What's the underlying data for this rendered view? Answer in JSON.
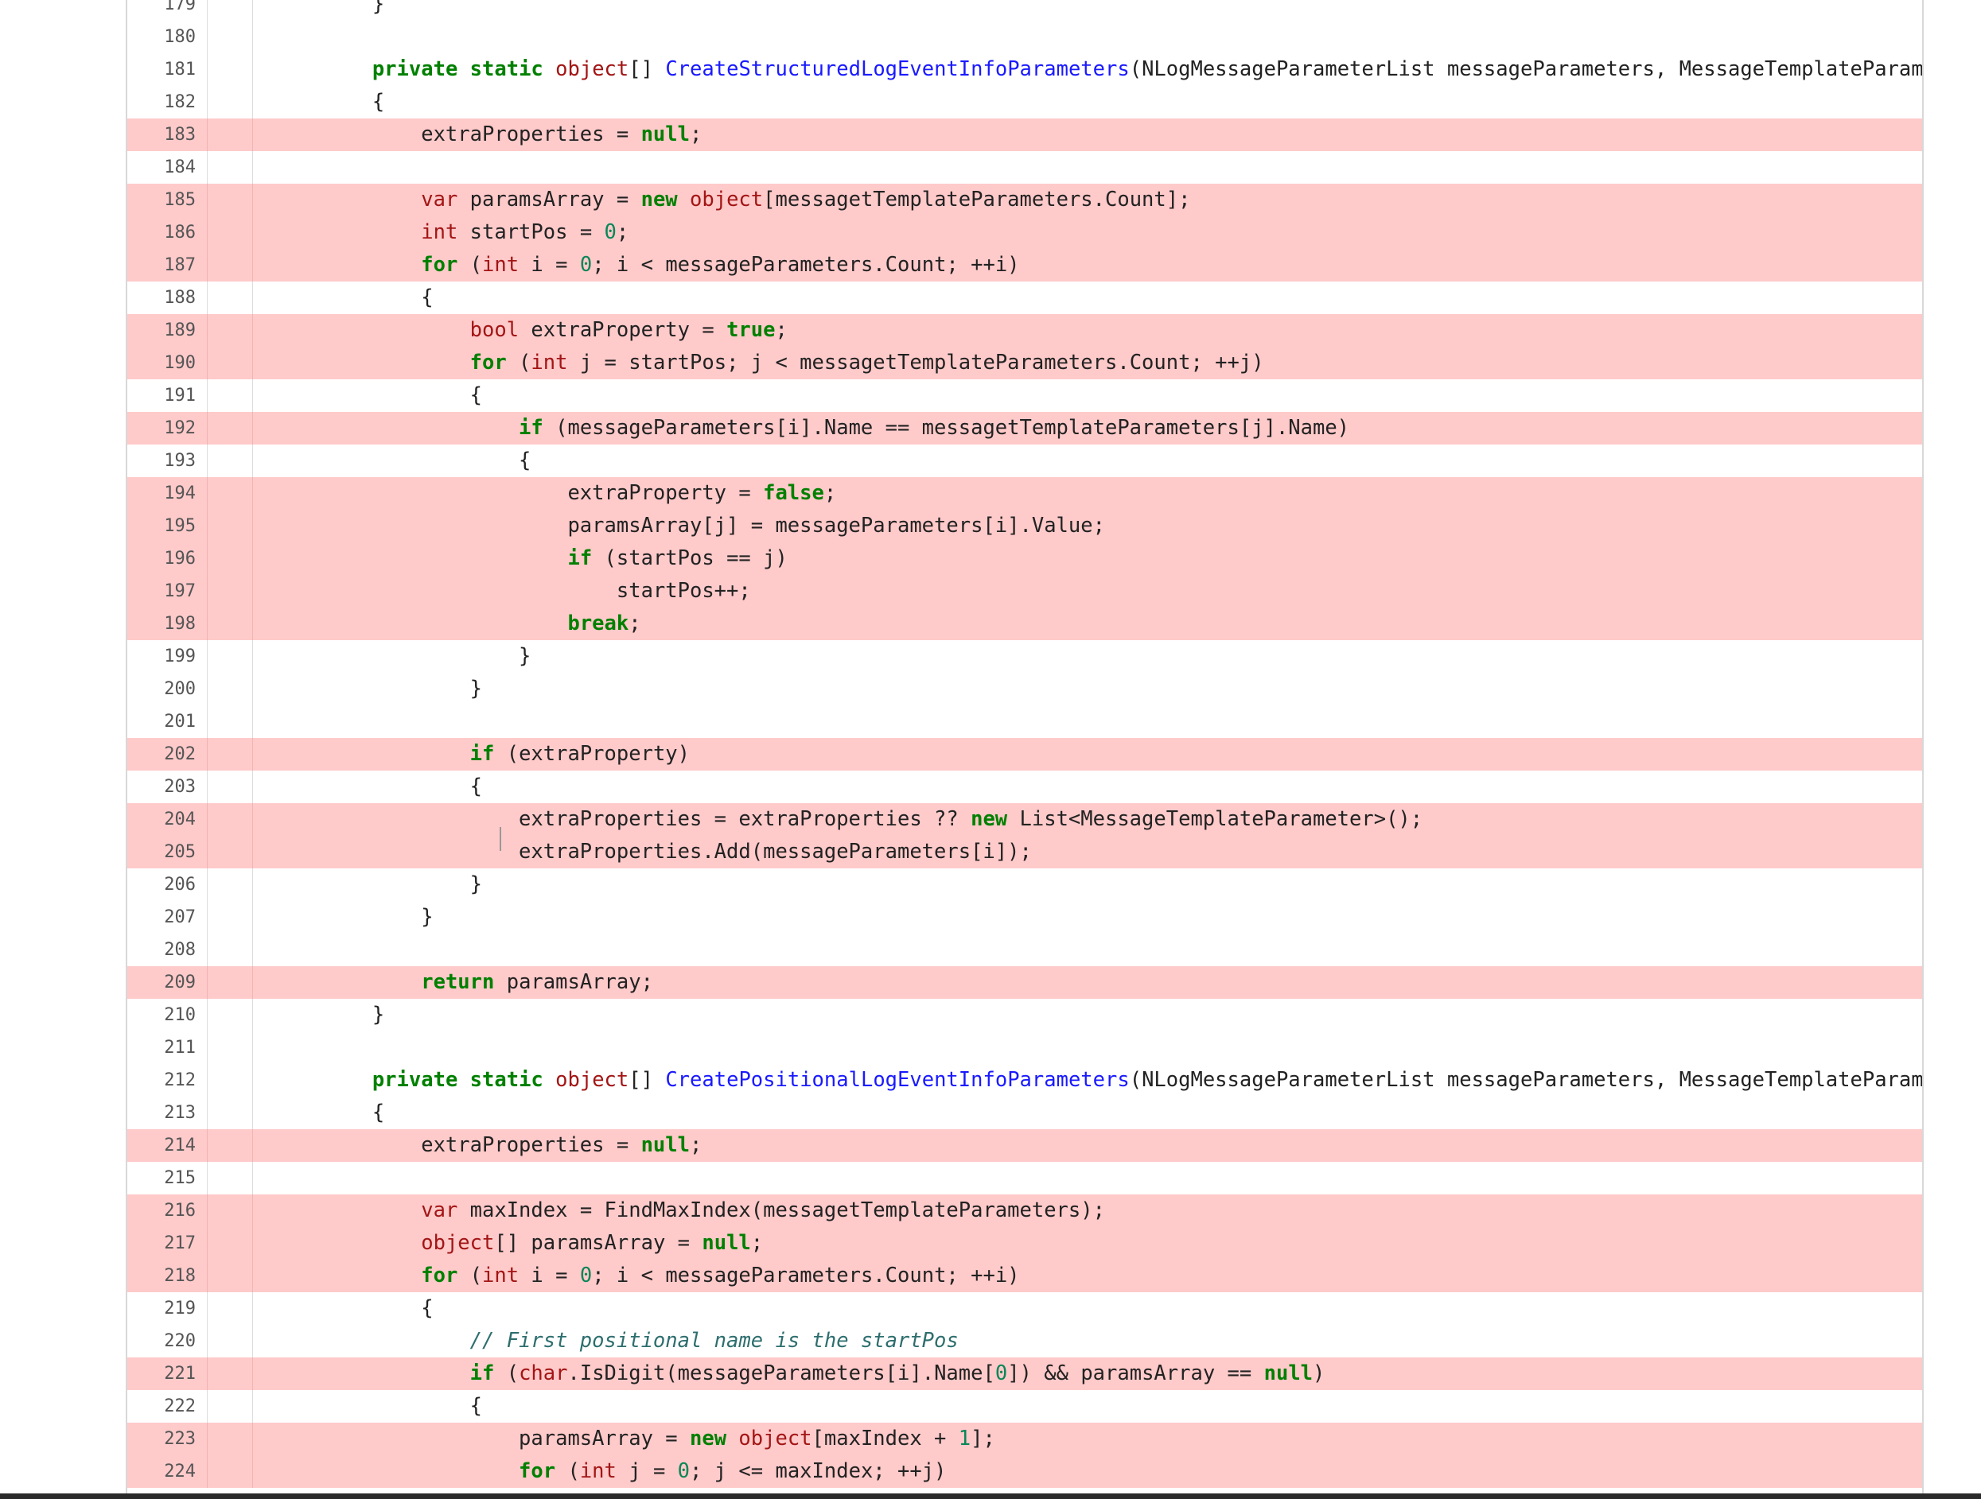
{
  "colors": {
    "highlight": "#ffcaca",
    "keyword": "#008000",
    "type": "#a31515",
    "function": "#1a1aff",
    "number": "#098658",
    "comment": "#2e6e6e"
  },
  "code_lines": [
    {
      "num": "179",
      "hl": false,
      "tokens": [
        [
          "p",
          "        }"
        ]
      ]
    },
    {
      "num": "180",
      "hl": false,
      "tokens": []
    },
    {
      "num": "181",
      "hl": false,
      "tokens": [
        [
          "p",
          "        "
        ],
        [
          "kw",
          "private"
        ],
        [
          "p",
          " "
        ],
        [
          "kw",
          "static"
        ],
        [
          "p",
          " "
        ],
        [
          "ty",
          "object"
        ],
        [
          "p",
          "[] "
        ],
        [
          "fn",
          "CreateStructuredLogEventInfoParameters"
        ],
        [
          "p",
          "(NLogMessageParameterList messageParameters, MessageTemplateParameters messa"
        ]
      ]
    },
    {
      "num": "182",
      "hl": false,
      "tokens": [
        [
          "p",
          "        {"
        ]
      ]
    },
    {
      "num": "183",
      "hl": true,
      "tokens": [
        [
          "p",
          "            extraProperties = "
        ],
        [
          "kw",
          "null"
        ],
        [
          "p",
          ";"
        ]
      ]
    },
    {
      "num": "184",
      "hl": false,
      "tokens": []
    },
    {
      "num": "185",
      "hl": true,
      "tokens": [
        [
          "p",
          "            "
        ],
        [
          "ty",
          "var"
        ],
        [
          "p",
          " paramsArray = "
        ],
        [
          "kw",
          "new"
        ],
        [
          "p",
          " "
        ],
        [
          "ty",
          "object"
        ],
        [
          "p",
          "[messagetTemplateParameters.Count];"
        ]
      ]
    },
    {
      "num": "186",
      "hl": true,
      "tokens": [
        [
          "p",
          "            "
        ],
        [
          "ty",
          "int"
        ],
        [
          "p",
          " startPos = "
        ],
        [
          "num",
          "0"
        ],
        [
          "p",
          ";"
        ]
      ]
    },
    {
      "num": "187",
      "hl": true,
      "tokens": [
        [
          "p",
          "            "
        ],
        [
          "kw",
          "for"
        ],
        [
          "p",
          " ("
        ],
        [
          "ty",
          "int"
        ],
        [
          "p",
          " i = "
        ],
        [
          "num",
          "0"
        ],
        [
          "p",
          "; i < messageParameters.Count; ++i)"
        ]
      ]
    },
    {
      "num": "188",
      "hl": false,
      "tokens": [
        [
          "p",
          "            {"
        ]
      ]
    },
    {
      "num": "189",
      "hl": true,
      "tokens": [
        [
          "p",
          "                "
        ],
        [
          "ty",
          "bool"
        ],
        [
          "p",
          " extraProperty = "
        ],
        [
          "kw",
          "true"
        ],
        [
          "p",
          ";"
        ]
      ]
    },
    {
      "num": "190",
      "hl": true,
      "tokens": [
        [
          "p",
          "                "
        ],
        [
          "kw",
          "for"
        ],
        [
          "p",
          " ("
        ],
        [
          "ty",
          "int"
        ],
        [
          "p",
          " j = startPos; j < messagetTemplateParameters.Count; ++j)"
        ]
      ]
    },
    {
      "num": "191",
      "hl": false,
      "tokens": [
        [
          "p",
          "                {"
        ]
      ]
    },
    {
      "num": "192",
      "hl": true,
      "tokens": [
        [
          "p",
          "                    "
        ],
        [
          "kw",
          "if"
        ],
        [
          "p",
          " (messageParameters[i].Name == messagetTemplateParameters[j].Name)"
        ]
      ]
    },
    {
      "num": "193",
      "hl": false,
      "tokens": [
        [
          "p",
          "                    {"
        ]
      ]
    },
    {
      "num": "194",
      "hl": true,
      "tokens": [
        [
          "p",
          "                        extraProperty = "
        ],
        [
          "kw",
          "false"
        ],
        [
          "p",
          ";"
        ]
      ]
    },
    {
      "num": "195",
      "hl": true,
      "tokens": [
        [
          "p",
          "                        paramsArray[j] = messageParameters[i].Value;"
        ]
      ]
    },
    {
      "num": "196",
      "hl": true,
      "tokens": [
        [
          "p",
          "                        "
        ],
        [
          "kw",
          "if"
        ],
        [
          "p",
          " (startPos == j)"
        ]
      ]
    },
    {
      "num": "197",
      "hl": true,
      "tokens": [
        [
          "p",
          "                            startPos++;"
        ]
      ]
    },
    {
      "num": "198",
      "hl": true,
      "tokens": [
        [
          "p",
          "                        "
        ],
        [
          "kw",
          "break"
        ],
        [
          "p",
          ";"
        ]
      ]
    },
    {
      "num": "199",
      "hl": false,
      "tokens": [
        [
          "p",
          "                    }"
        ]
      ]
    },
    {
      "num": "200",
      "hl": false,
      "tokens": [
        [
          "p",
          "                }"
        ]
      ]
    },
    {
      "num": "201",
      "hl": false,
      "tokens": []
    },
    {
      "num": "202",
      "hl": true,
      "tokens": [
        [
          "p",
          "                "
        ],
        [
          "kw",
          "if"
        ],
        [
          "p",
          " (extraProperty)"
        ]
      ]
    },
    {
      "num": "203",
      "hl": false,
      "tokens": [
        [
          "p",
          "                {"
        ]
      ]
    },
    {
      "num": "204",
      "hl": true,
      "tokens": [
        [
          "p",
          "                    extraProperties = extraProperties ?? "
        ],
        [
          "kw",
          "new"
        ],
        [
          "p",
          " List<MessageTemplateParameter>();"
        ]
      ]
    },
    {
      "num": "205",
      "hl": true,
      "tokens": [
        [
          "p",
          "                    extraProperties.Add(messageParameters[i]);"
        ]
      ]
    },
    {
      "num": "206",
      "hl": false,
      "tokens": [
        [
          "p",
          "                }"
        ]
      ]
    },
    {
      "num": "207",
      "hl": false,
      "tokens": [
        [
          "p",
          "            }"
        ]
      ]
    },
    {
      "num": "208",
      "hl": false,
      "tokens": []
    },
    {
      "num": "209",
      "hl": true,
      "tokens": [
        [
          "p",
          "            "
        ],
        [
          "kw",
          "return"
        ],
        [
          "p",
          " paramsArray;"
        ]
      ]
    },
    {
      "num": "210",
      "hl": false,
      "tokens": [
        [
          "p",
          "        }"
        ]
      ]
    },
    {
      "num": "211",
      "hl": false,
      "tokens": []
    },
    {
      "num": "212",
      "hl": false,
      "tokens": [
        [
          "p",
          "        "
        ],
        [
          "kw",
          "private"
        ],
        [
          "p",
          " "
        ],
        [
          "kw",
          "static"
        ],
        [
          "p",
          " "
        ],
        [
          "ty",
          "object"
        ],
        [
          "p",
          "[] "
        ],
        [
          "fn",
          "CreatePositionalLogEventInfoParameters"
        ],
        [
          "p",
          "(NLogMessageParameterList messageParameters, MessageTemplateParameters messa"
        ]
      ]
    },
    {
      "num": "213",
      "hl": false,
      "tokens": [
        [
          "p",
          "        {"
        ]
      ]
    },
    {
      "num": "214",
      "hl": true,
      "tokens": [
        [
          "p",
          "            extraProperties = "
        ],
        [
          "kw",
          "null"
        ],
        [
          "p",
          ";"
        ]
      ]
    },
    {
      "num": "215",
      "hl": false,
      "tokens": []
    },
    {
      "num": "216",
      "hl": true,
      "tokens": [
        [
          "p",
          "            "
        ],
        [
          "ty",
          "var"
        ],
        [
          "p",
          " maxIndex = FindMaxIndex(messagetTemplateParameters);"
        ]
      ]
    },
    {
      "num": "217",
      "hl": true,
      "tokens": [
        [
          "p",
          "            "
        ],
        [
          "ty",
          "object"
        ],
        [
          "p",
          "[] paramsArray = "
        ],
        [
          "kw",
          "null"
        ],
        [
          "p",
          ";"
        ]
      ]
    },
    {
      "num": "218",
      "hl": true,
      "tokens": [
        [
          "p",
          "            "
        ],
        [
          "kw",
          "for"
        ],
        [
          "p",
          " ("
        ],
        [
          "ty",
          "int"
        ],
        [
          "p",
          " i = "
        ],
        [
          "num",
          "0"
        ],
        [
          "p",
          "; i < messageParameters.Count; ++i)"
        ]
      ]
    },
    {
      "num": "219",
      "hl": false,
      "tokens": [
        [
          "p",
          "            {"
        ]
      ]
    },
    {
      "num": "220",
      "hl": false,
      "tokens": [
        [
          "p",
          "                "
        ],
        [
          "cm",
          "// First positional name is the startPos"
        ]
      ]
    },
    {
      "num": "221",
      "hl": true,
      "tokens": [
        [
          "p",
          "                "
        ],
        [
          "kw",
          "if"
        ],
        [
          "p",
          " ("
        ],
        [
          "ty",
          "char"
        ],
        [
          "p",
          ".IsDigit(messageParameters[i].Name["
        ],
        [
          "num",
          "0"
        ],
        [
          "p",
          "]) && paramsArray == "
        ],
        [
          "kw",
          "null"
        ],
        [
          "p",
          ")"
        ]
      ]
    },
    {
      "num": "222",
      "hl": false,
      "tokens": [
        [
          "p",
          "                {"
        ]
      ]
    },
    {
      "num": "223",
      "hl": true,
      "tokens": [
        [
          "p",
          "                    paramsArray = "
        ],
        [
          "kw",
          "new"
        ],
        [
          "p",
          " "
        ],
        [
          "ty",
          "object"
        ],
        [
          "p",
          "[maxIndex + "
        ],
        [
          "num",
          "1"
        ],
        [
          "p",
          "];"
        ]
      ]
    },
    {
      "num": "224",
      "hl": true,
      "tokens": [
        [
          "p",
          "                    "
        ],
        [
          "kw",
          "for"
        ],
        [
          "p",
          " ("
        ],
        [
          "ty",
          "int"
        ],
        [
          "p",
          " j = "
        ],
        [
          "num",
          "0"
        ],
        [
          "p",
          "; j <= maxIndex; ++j)"
        ]
      ]
    }
  ]
}
